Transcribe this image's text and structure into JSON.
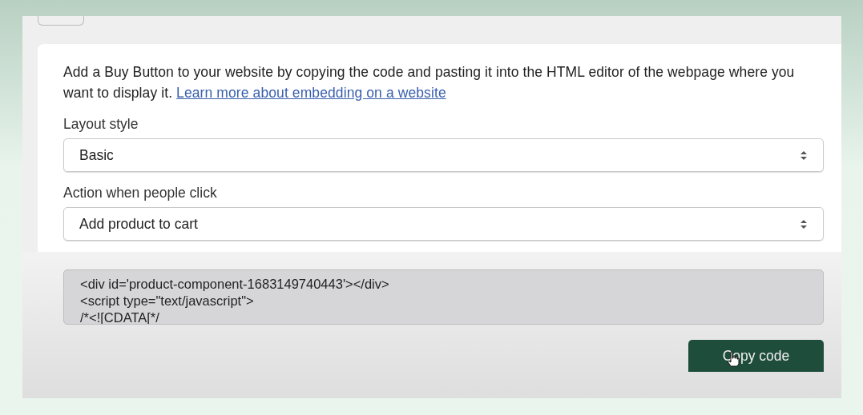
{
  "intro": {
    "text": "Add a Buy Button to your website by copying the code and pasting it into the HTML editor of the webpage where you want to display it.",
    "link": "Learn more about embedding on a website"
  },
  "selects": [
    {
      "label": "Layout style",
      "value": "Basic"
    },
    {
      "label": "Action when people click",
      "value": "Add product to cart"
    }
  ],
  "code": [
    "<div id='product-component-1683149740443'></div>",
    "<script type=\"text/javascript\">",
    "/*<![CDATA[*/"
  ],
  "copy_button": "Copy code"
}
